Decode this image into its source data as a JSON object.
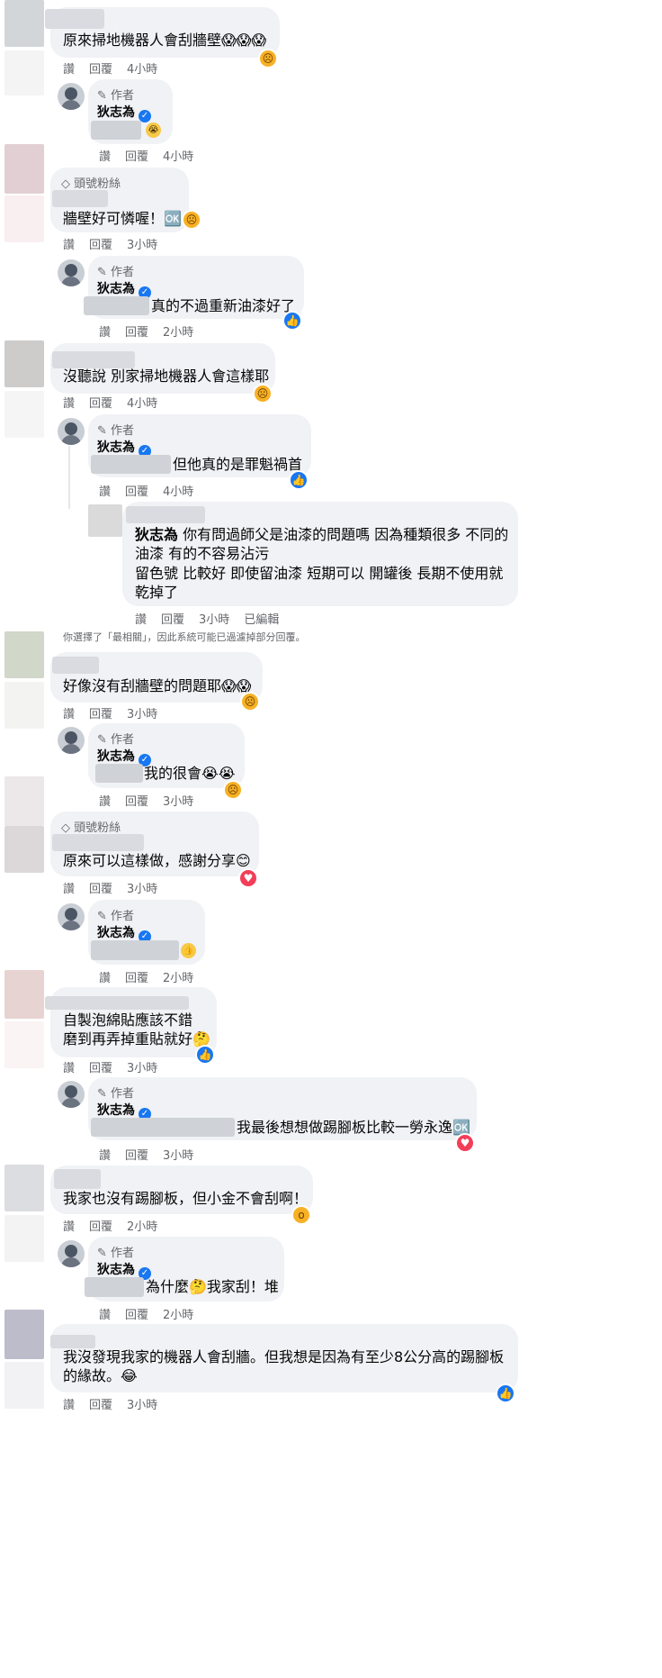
{
  "labels": {
    "author": "作者",
    "top_fan": "頭號粉絲",
    "edited": "已編輯"
  },
  "actions": {
    "like": "讚",
    "reply": "回覆"
  },
  "author_name": "狄志為",
  "notice": "你選擇了「最相關」，因此系統可能已過濾掉部分回覆。",
  "comments": [
    {
      "text": "原來掃地機器人會刮牆壁😱😱😱",
      "time": "4小時"
    },
    {
      "reply_time": "4小時"
    },
    {
      "text": "牆壁好可憐喔！🆗",
      "time": "3小時"
    },
    {
      "reply_text": "真的不過重新油漆好了",
      "reply_time": "2小時"
    },
    {
      "text": "沒聽說 別家掃地機器人會這樣耶",
      "time": "4小時"
    },
    {
      "reply_text": "但他真的是罪魁禍首",
      "reply_time": "4小時"
    },
    {
      "sub_line1": "你有問過師父是油漆的問題嗎 因為種類很多 不同的",
      "sub_line2": "油漆 有的不容易沾污",
      "sub_line3": "留色號 比較好 即使留油漆 短期可以 開罐後 長期不使用就",
      "sub_line4": "乾掉了",
      "sub_time": "3小時"
    },
    {
      "text": "好像沒有刮牆壁的問題耶😱😱",
      "time": "3小時"
    },
    {
      "reply_text": "我的很會😭😭",
      "reply_time": "3小時"
    },
    {
      "text": "原來可以這樣做，感謝分享😊",
      "time": "3小時"
    },
    {
      "reply_time": "2小時"
    },
    {
      "line1": "自製泡綿貼應該不錯",
      "line2": "磨到再弄掉重貼就好🤔",
      "time": "3小時"
    },
    {
      "reply_text": "我最後想想做踢腳板比較一勞永逸🆗",
      "reply_time": "3小時"
    },
    {
      "text": "我家也沒有踢腳板，但小金不會刮啊！",
      "time": "2小時"
    },
    {
      "reply_text": "為什麼🤔我家刮！堆",
      "reply_time": "2小時"
    },
    {
      "line1": "我沒發現我家的機器人會刮牆。但我想是因為有至少8公分高的踢腳板",
      "line2": "的緣故。😂",
      "time": "3小時"
    }
  ]
}
